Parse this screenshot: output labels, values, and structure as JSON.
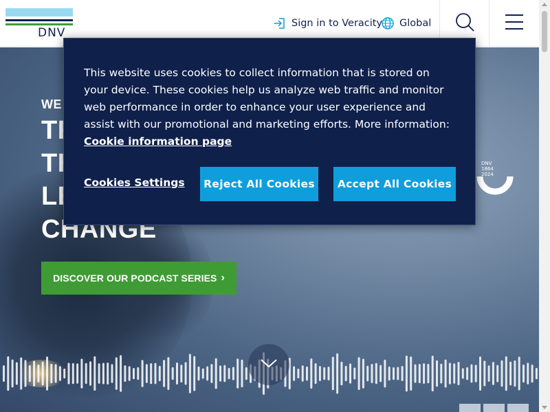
{
  "header": {
    "logo_text": "DNV",
    "signin_label": "Sign in to Veracity",
    "global_label": "Global",
    "icons": {
      "signin": "sign-in-icon",
      "global": "globe-icon",
      "search": "search-icon",
      "menu": "hamburger-menu-icon"
    }
  },
  "hero": {
    "kicker": "WE",
    "lines": [
      "TR",
      "TH",
      "LE",
      "CHANGE"
    ],
    "cta_label": "DISCOVER OUR PODCAST SERIES",
    "cta_chevron": "›",
    "anniversary": {
      "name": "DNV",
      "start": "1864",
      "end": "2024"
    },
    "scroll_icon": "chevron-down-icon"
  },
  "cookie": {
    "text": "This website uses cookies to collect information that is stored on your device. These cookies help us analyze web traffic and monitor web performance in order to enhance your user experience and assist with our promotional and marketing efforts. More information: ",
    "link_text": "Cookie information page",
    "settings_label": "Cookies Settings",
    "reject_label": "Reject All Cookies",
    "accept_label": "Accept All Cookies"
  },
  "colors": {
    "navy": "#0f204b",
    "accent_blue": "#0f9edb",
    "green": "#3f9c35",
    "logo_light_blue": "#99d9f0"
  }
}
